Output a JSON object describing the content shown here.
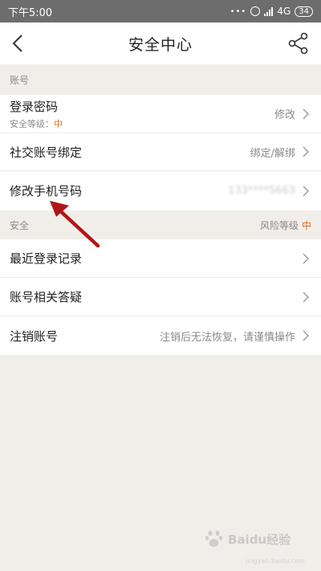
{
  "status_bar": {
    "time": "下午5:00",
    "network": "4G",
    "battery": "34"
  },
  "nav": {
    "title": "安全中心"
  },
  "sections": {
    "account": {
      "title": "账号"
    },
    "security": {
      "title": "安全",
      "risk_label": "风险等级",
      "risk_value": "中"
    }
  },
  "rows": {
    "password": {
      "label": "登录密码",
      "sub_label": "安全等级：",
      "sub_value": "中",
      "action": "修改"
    },
    "social": {
      "label": "社交账号绑定",
      "action": "绑定/解绑"
    },
    "phone": {
      "label": "修改手机号码",
      "value": "133****5663"
    },
    "login_history": {
      "label": "最近登录记录"
    },
    "faq": {
      "label": "账号相关答疑"
    },
    "cancel": {
      "label": "注销账号",
      "hint": "注销后无法恢复，请谨慎操作"
    }
  },
  "watermark": {
    "brand": "Baidu经验",
    "url": "jingyan.baidu.com"
  },
  "colors": {
    "accent": "#e06a1b",
    "arrow": "#b01717",
    "status_bar": "#6d6d6d"
  }
}
